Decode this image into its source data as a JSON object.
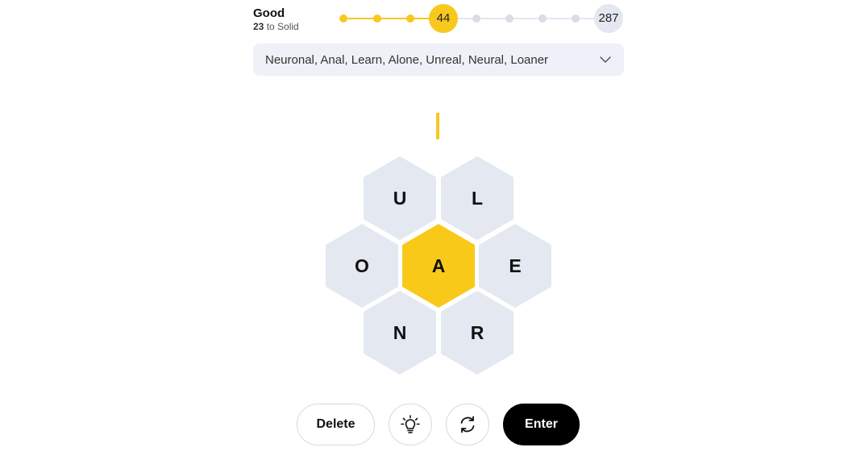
{
  "progress": {
    "rank": "Good",
    "to_next_count": "23",
    "to_next_label": "to Solid",
    "current_score": "44",
    "max_score": "287",
    "reached_fraction": 0.375,
    "accent_color": "#f7c81e",
    "track_color": "#e3e7ef"
  },
  "found_words": {
    "text": "Neuronal, Anal, Learn, Alone, Unreal, Neural, Loaner",
    "icon": "chevron-down-icon"
  },
  "hive": {
    "center_letter": "A",
    "outer_letters": {
      "top_left": "U",
      "top_right": "L",
      "mid_left": "O",
      "mid_right": "E",
      "bottom_left": "N",
      "bottom_right": "R"
    },
    "center_color": "#f8c919",
    "outer_color": "#e3e8f1"
  },
  "controls": {
    "delete_label": "Delete",
    "hint_icon": "lightbulb-icon",
    "shuffle_icon": "shuffle-icon",
    "enter_label": "Enter"
  }
}
